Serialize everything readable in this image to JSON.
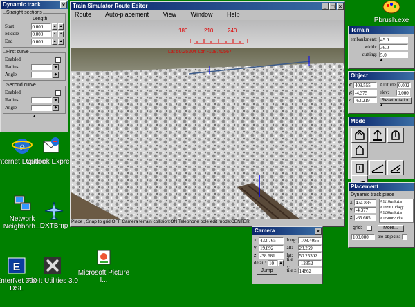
{
  "desktop": {
    "pbrush": "Pbrush.exe",
    "icons": [
      {
        "label": "Internet Explorer"
      },
      {
        "label": "Outlook Express"
      },
      {
        "label": "Network Neighborh..."
      },
      {
        "label": "DXTBmp"
      },
      {
        "label": "Microsoft Picture I..."
      },
      {
        "label": "EnterNet 300 DSL"
      },
      {
        "label": "Fix-It Utilities 3.0"
      }
    ]
  },
  "dynamic_track": {
    "title": "Dynamic track",
    "straight_title": "Straight sections",
    "length_header": "Length",
    "start_label": "Start",
    "start_value": "0.000",
    "middle_label": "Middle",
    "middle_value": "0.000",
    "end_label": "End",
    "end_value": "0.000",
    "first_curve_title": "First curve",
    "second_curve_title": "Second curve",
    "enabled_label": "Enabled",
    "radius_label": "Radius",
    "angle_label": "Angle"
  },
  "editor": {
    "title": "Train Simulator Route Editor",
    "menu": [
      "Route",
      "Auto-placement",
      "View",
      "Window",
      "Help"
    ],
    "compass": [
      "180",
      "210",
      "240"
    ],
    "coords": "Lat 50.25304 Lon -108.40567",
    "status": "Place , Snap to grid:OFF Camera terrain collision:ON Telephone pole edit mode:CENTER"
  },
  "terrain": {
    "title": "Terrain",
    "embankment_label": "embankment:",
    "embankment_value": "45.0",
    "width_label": "width:",
    "width_value": "36.0",
    "cutting_label": "cutting:",
    "cutting_value": "5.0"
  },
  "object": {
    "title": "Object",
    "x_label": "x:",
    "x_value": "409.555",
    "y_label": "y:",
    "y_value": "-4.375",
    "z_label": "z:",
    "z_value": "-63.219",
    "altitude_label": "Altitude",
    "altitude_value": "0.002",
    "elev_label": "elev:",
    "elev_value": "0.000",
    "reset_label": "Reset rotation"
  },
  "mode": {
    "title": "Mode"
  },
  "placement": {
    "title": "Placement",
    "piece_label": "Dynamic track piece",
    "x_value": "424.835",
    "y_value": "-4.377",
    "z_value": "-65.665",
    "list": [
      "A1t10mStrt.s",
      "A1tPnt10dRgt",
      "A1t50mStrt.s",
      "A1t500r20d.s"
    ],
    "grid_label": "grid:",
    "grid_value": "100.000",
    "more_label": "More...",
    "tile_objects_label": "tile objects:"
  },
  "camera": {
    "title": "Camera",
    "x_value": "432.765",
    "y_value": "19.892",
    "z_value": "-38.681",
    "long_label": "long:",
    "long_value": "-108.4056",
    "alt_label": "alt:",
    "alt_value": "23.269",
    "lat_label": "lat:",
    "lat_value": "50.25302",
    "tilex_label": "tile x:",
    "tilex_value": "-12352",
    "tilez_label": "tile z:",
    "tilez_value": "14862",
    "detail_label": "detail:",
    "detail_value": "10",
    "jump_label": "Jump"
  }
}
